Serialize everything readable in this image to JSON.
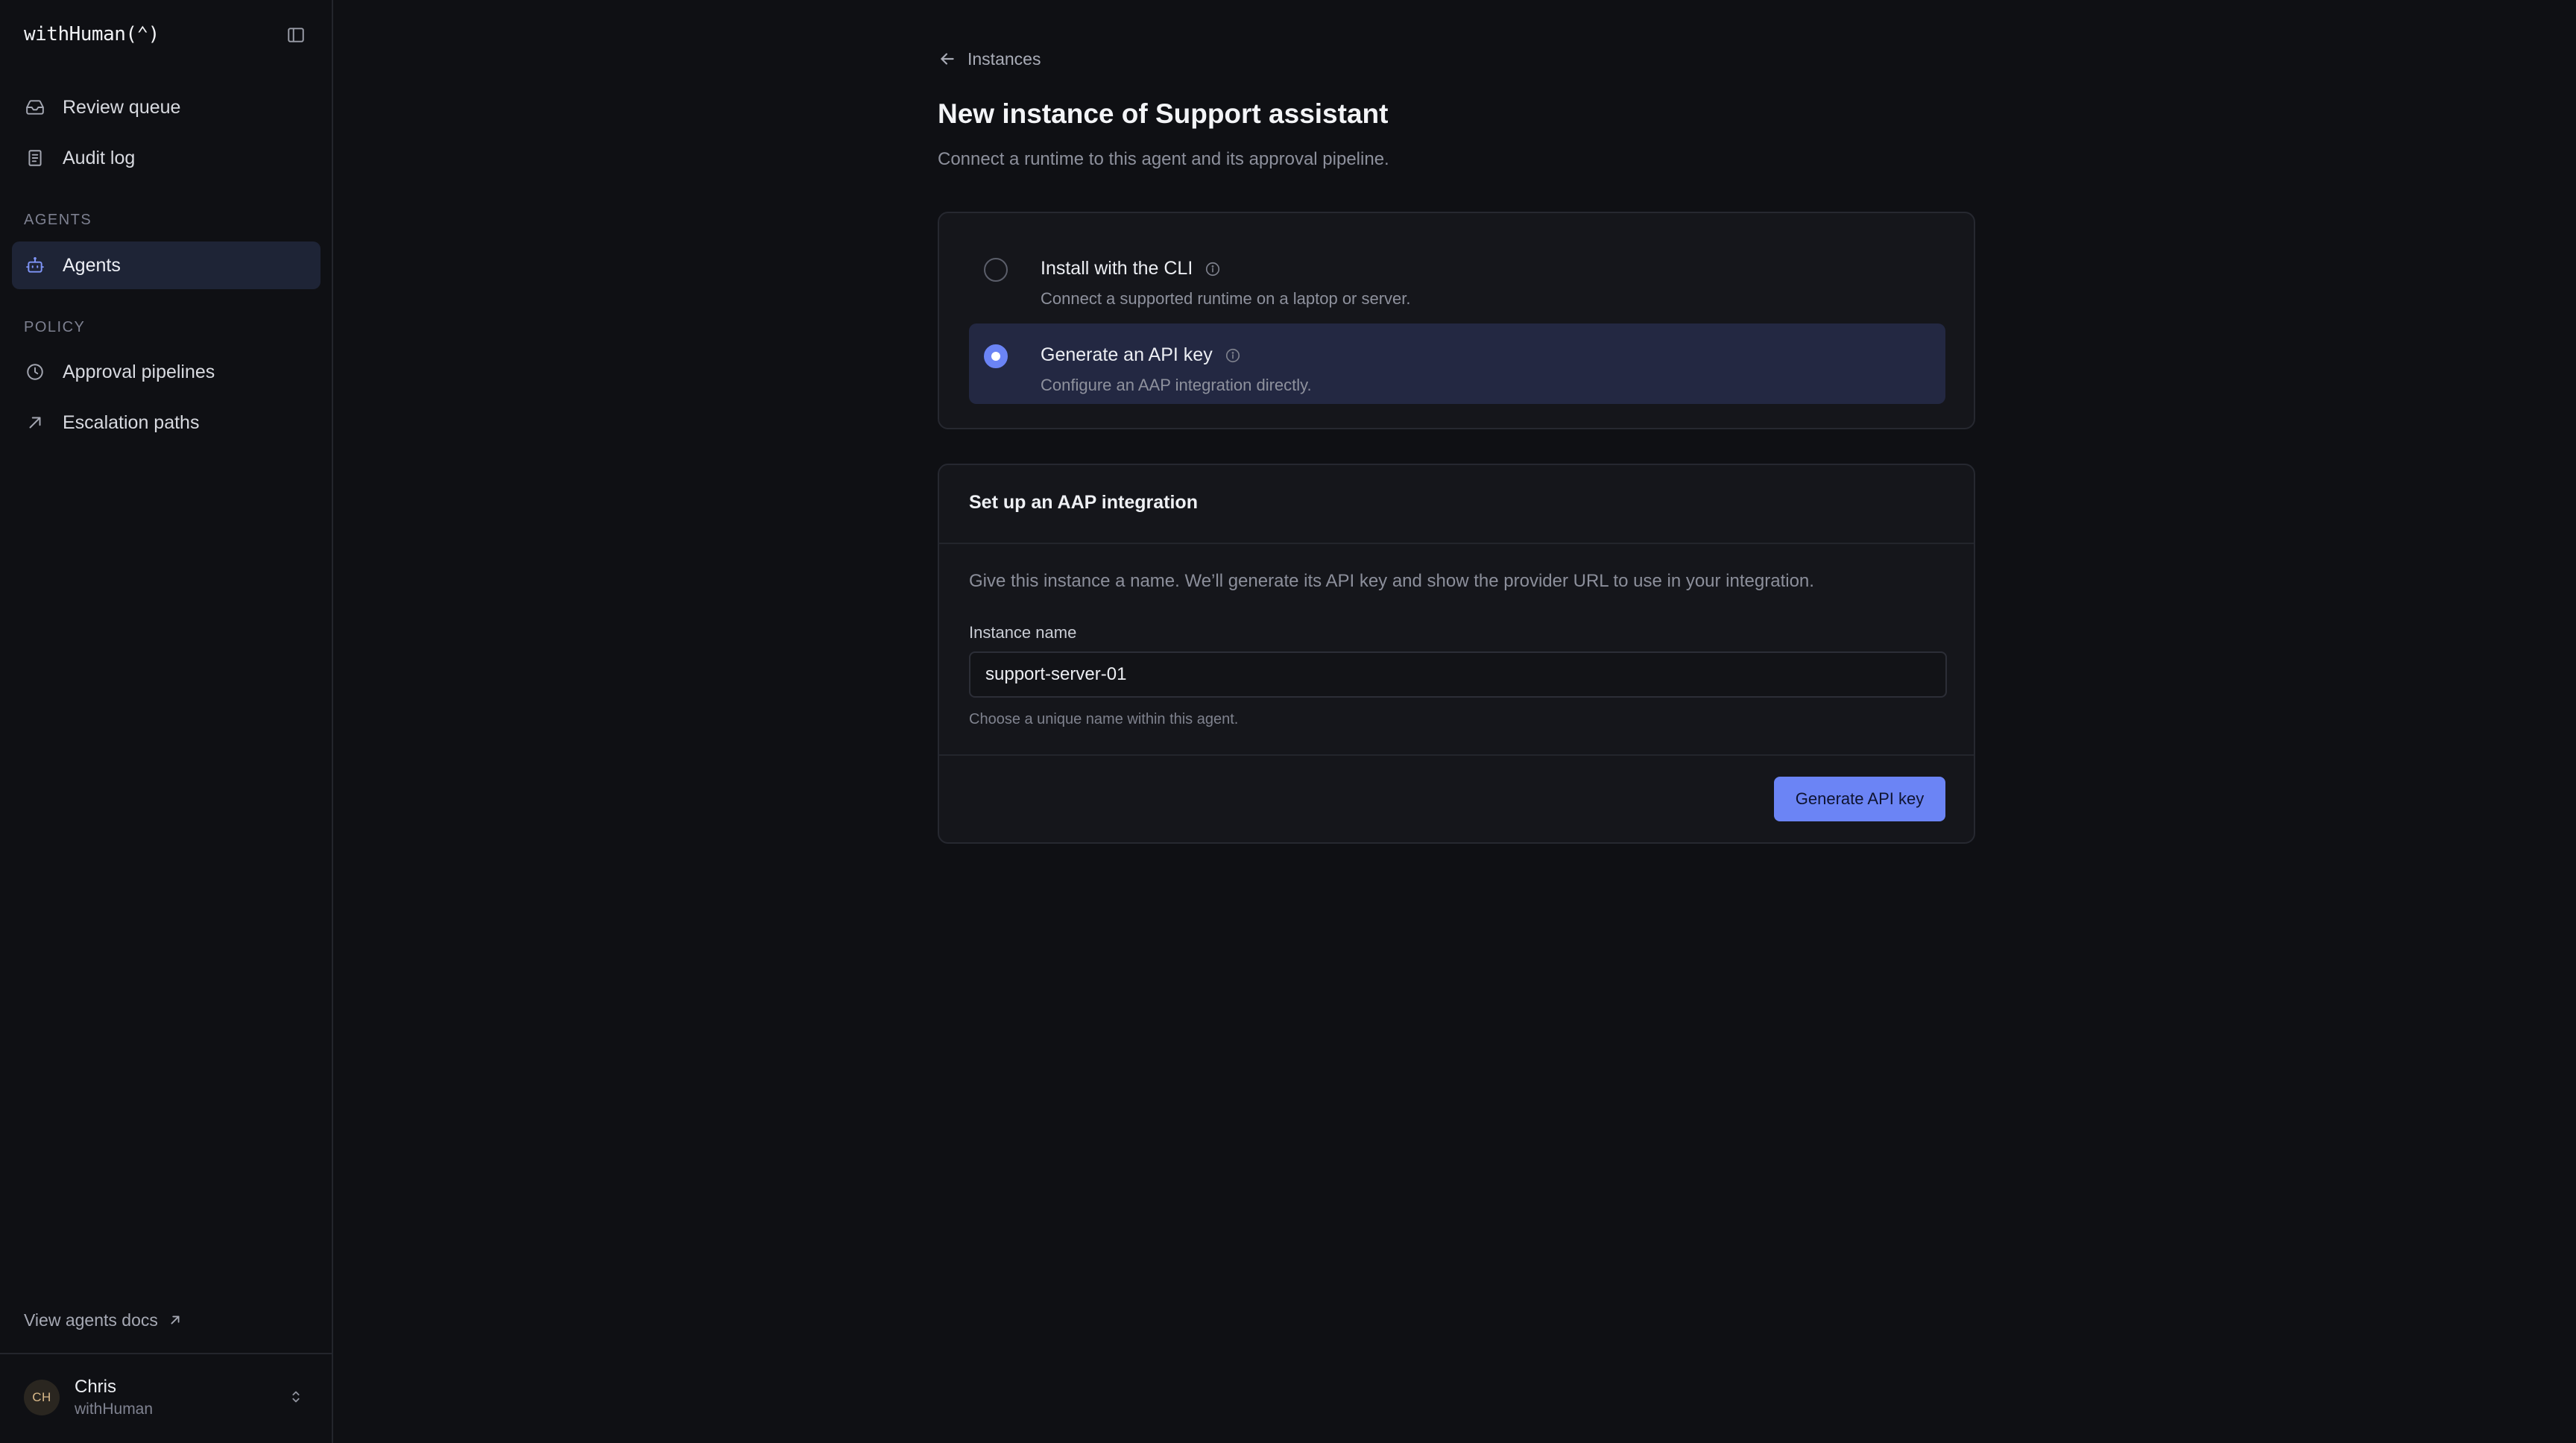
{
  "brand": {
    "logo_text": "withHuman(⌃)"
  },
  "sidebar": {
    "collapse_icon": "sidebar-toggle-icon",
    "top_items": [
      {
        "label": "Review queue",
        "icon": "inbox-icon"
      },
      {
        "label": "Audit log",
        "icon": "document-icon"
      }
    ],
    "sections": [
      {
        "label": "AGENTS",
        "items": [
          {
            "label": "Agents",
            "icon": "robot-icon",
            "active": true
          }
        ]
      },
      {
        "label": "POLICY",
        "items": [
          {
            "label": "Approval pipelines",
            "icon": "clock-icon"
          },
          {
            "label": "Escalation paths",
            "icon": "arrow-up-right-icon"
          }
        ]
      }
    ],
    "docs_link": {
      "label": "View agents docs",
      "icon": "external-arrow-icon"
    },
    "user": {
      "initials": "CH",
      "name": "Chris",
      "org": "withHuman"
    }
  },
  "main": {
    "breadcrumb": {
      "label": "Instances",
      "icon": "arrow-left-icon"
    },
    "title": "New instance of Support assistant",
    "subtitle": "Connect a runtime to this agent and its approval pipeline.",
    "options": [
      {
        "title": "Install with the CLI",
        "description": "Connect a supported runtime on a laptop or server.",
        "selected": false
      },
      {
        "title": "Generate an API key",
        "description": "Configure an AAP integration directly.",
        "selected": true
      }
    ],
    "setup": {
      "title": "Set up an AAP integration",
      "description": "Give this instance a name. We’ll generate its API key and show the provider URL to use in your integration.",
      "field_label": "Instance name",
      "field_value": "support-server-01",
      "field_help": "Choose a unique name within this agent.",
      "button_label": "Generate API key"
    }
  },
  "colors": {
    "background": "#0f1014",
    "card": "#15161b",
    "accent": "#6b84f5",
    "selected_option": "#232842",
    "active_nav": "#1e2436"
  }
}
